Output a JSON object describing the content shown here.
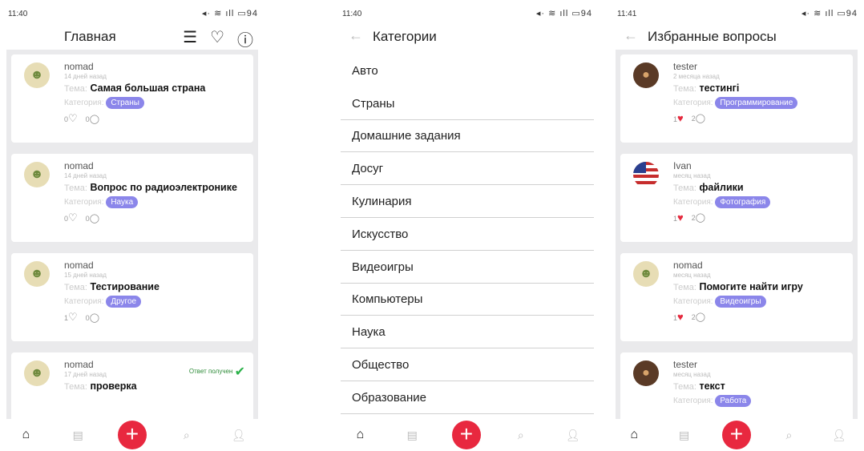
{
  "screens": {
    "home": {
      "status_time": "11:40",
      "status_right": "◂· ≋ ıll ▭94",
      "title": "Главная",
      "posts": [
        {
          "user": "nomad",
          "ago": "14 дней назад",
          "topic_label": "Тема:",
          "topic": "Самая большая страна",
          "cat_label": "Категория:",
          "category": "Страны",
          "likes": "0",
          "comments": "0"
        },
        {
          "user": "nomad",
          "ago": "14 дней назад",
          "topic_label": "Тема:",
          "topic": "Вопрос по радиоэлектронике",
          "cat_label": "Категория:",
          "category": "Наука",
          "likes": "0",
          "comments": "0"
        },
        {
          "user": "nomad",
          "ago": "15 дней назад",
          "topic_label": "Тема:",
          "topic": "Тестирование",
          "cat_label": "Категория:",
          "category": "Другое",
          "likes": "1",
          "comments": "0"
        },
        {
          "user": "nomad",
          "ago": "17 дней назад",
          "topic_label": "Тема:",
          "topic": "проверка",
          "answered": "Ответ получен"
        }
      ]
    },
    "categories": {
      "status_time": "11:40",
      "status_right": "◂· ≋ ıll ▭94",
      "title": "Категории",
      "items": [
        "Авто",
        "Страны",
        "Домашние задания",
        "Досуг",
        "Кулинария",
        "Искусство",
        "Видеоигры",
        "Компьютеры",
        "Наука",
        "Общество",
        "Образование"
      ]
    },
    "favorites": {
      "status_time": "11:41",
      "status_right": "◂· ≋ ıll ▭94",
      "title": "Избранные вопросы",
      "posts": [
        {
          "user": "tester",
          "ago": "2 месяца назад",
          "topic_label": "Тема:",
          "topic": "тестингі",
          "cat_label": "Категория:",
          "category": "Программирование",
          "likes": "1",
          "comments": "2"
        },
        {
          "user": "Ivan",
          "ago": "месяц назад",
          "topic_label": "Тема:",
          "topic": "файлики",
          "cat_label": "Категория:",
          "category": "Фотография",
          "likes": "1",
          "comments": "2"
        },
        {
          "user": "nomad",
          "ago": "месяц назад",
          "topic_label": "Тема:",
          "topic": "Помогите найти игру",
          "cat_label": "Категория:",
          "category": "Видеоигры",
          "likes": "1",
          "comments": "2"
        },
        {
          "user": "tester",
          "ago": "месяц назад",
          "topic_label": "Тема:",
          "topic": "текст",
          "cat_label": "Категория:",
          "category": "Работа"
        }
      ]
    }
  },
  "colors": {
    "accent": "#8b86ea",
    "fab": "#e8283f",
    "liked": "#e52a3e",
    "answered": "#2bb24a"
  }
}
